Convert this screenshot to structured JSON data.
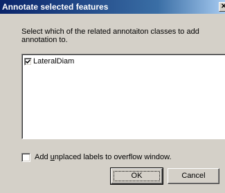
{
  "window": {
    "title": "Annotate selected features",
    "close_glyph": "✕"
  },
  "instruction": "Select which of the related annotaiton classes to add annotation to.",
  "annotation_classes": [
    {
      "label": "LateralDiam",
      "checked": true
    }
  ],
  "overflow_option": {
    "label_pre": "Add ",
    "label_accel": "u",
    "label_post": "nplaced labels to overflow window.",
    "checked": false
  },
  "buttons": {
    "ok_label": "OK",
    "cancel_label": "Cancel"
  },
  "colors": {
    "title_gradient_start": "#0a246a",
    "title_gradient_end": "#a6caf0",
    "dialog_face": "#d4d0c8",
    "list_background": "#ffffff"
  },
  "icons": {
    "close": "close-icon",
    "check": "checkmark-icon"
  }
}
